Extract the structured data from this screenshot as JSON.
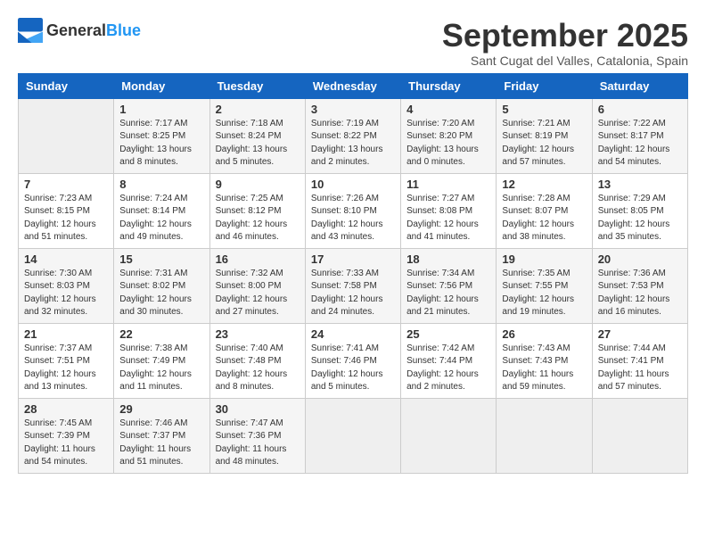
{
  "header": {
    "logo_general": "General",
    "logo_blue": "Blue",
    "month_title": "September 2025",
    "location": "Sant Cugat del Valles, Catalonia, Spain"
  },
  "days_of_week": [
    "Sunday",
    "Monday",
    "Tuesday",
    "Wednesday",
    "Thursday",
    "Friday",
    "Saturday"
  ],
  "weeks": [
    [
      {
        "day": "",
        "info": ""
      },
      {
        "day": "1",
        "info": "Sunrise: 7:17 AM\nSunset: 8:25 PM\nDaylight: 13 hours\nand 8 minutes."
      },
      {
        "day": "2",
        "info": "Sunrise: 7:18 AM\nSunset: 8:24 PM\nDaylight: 13 hours\nand 5 minutes."
      },
      {
        "day": "3",
        "info": "Sunrise: 7:19 AM\nSunset: 8:22 PM\nDaylight: 13 hours\nand 2 minutes."
      },
      {
        "day": "4",
        "info": "Sunrise: 7:20 AM\nSunset: 8:20 PM\nDaylight: 13 hours\nand 0 minutes."
      },
      {
        "day": "5",
        "info": "Sunrise: 7:21 AM\nSunset: 8:19 PM\nDaylight: 12 hours\nand 57 minutes."
      },
      {
        "day": "6",
        "info": "Sunrise: 7:22 AM\nSunset: 8:17 PM\nDaylight: 12 hours\nand 54 minutes."
      }
    ],
    [
      {
        "day": "7",
        "info": "Sunrise: 7:23 AM\nSunset: 8:15 PM\nDaylight: 12 hours\nand 51 minutes."
      },
      {
        "day": "8",
        "info": "Sunrise: 7:24 AM\nSunset: 8:14 PM\nDaylight: 12 hours\nand 49 minutes."
      },
      {
        "day": "9",
        "info": "Sunrise: 7:25 AM\nSunset: 8:12 PM\nDaylight: 12 hours\nand 46 minutes."
      },
      {
        "day": "10",
        "info": "Sunrise: 7:26 AM\nSunset: 8:10 PM\nDaylight: 12 hours\nand 43 minutes."
      },
      {
        "day": "11",
        "info": "Sunrise: 7:27 AM\nSunset: 8:08 PM\nDaylight: 12 hours\nand 41 minutes."
      },
      {
        "day": "12",
        "info": "Sunrise: 7:28 AM\nSunset: 8:07 PM\nDaylight: 12 hours\nand 38 minutes."
      },
      {
        "day": "13",
        "info": "Sunrise: 7:29 AM\nSunset: 8:05 PM\nDaylight: 12 hours\nand 35 minutes."
      }
    ],
    [
      {
        "day": "14",
        "info": "Sunrise: 7:30 AM\nSunset: 8:03 PM\nDaylight: 12 hours\nand 32 minutes."
      },
      {
        "day": "15",
        "info": "Sunrise: 7:31 AM\nSunset: 8:02 PM\nDaylight: 12 hours\nand 30 minutes."
      },
      {
        "day": "16",
        "info": "Sunrise: 7:32 AM\nSunset: 8:00 PM\nDaylight: 12 hours\nand 27 minutes."
      },
      {
        "day": "17",
        "info": "Sunrise: 7:33 AM\nSunset: 7:58 PM\nDaylight: 12 hours\nand 24 minutes."
      },
      {
        "day": "18",
        "info": "Sunrise: 7:34 AM\nSunset: 7:56 PM\nDaylight: 12 hours\nand 21 minutes."
      },
      {
        "day": "19",
        "info": "Sunrise: 7:35 AM\nSunset: 7:55 PM\nDaylight: 12 hours\nand 19 minutes."
      },
      {
        "day": "20",
        "info": "Sunrise: 7:36 AM\nSunset: 7:53 PM\nDaylight: 12 hours\nand 16 minutes."
      }
    ],
    [
      {
        "day": "21",
        "info": "Sunrise: 7:37 AM\nSunset: 7:51 PM\nDaylight: 12 hours\nand 13 minutes."
      },
      {
        "day": "22",
        "info": "Sunrise: 7:38 AM\nSunset: 7:49 PM\nDaylight: 12 hours\nand 11 minutes."
      },
      {
        "day": "23",
        "info": "Sunrise: 7:40 AM\nSunset: 7:48 PM\nDaylight: 12 hours\nand 8 minutes."
      },
      {
        "day": "24",
        "info": "Sunrise: 7:41 AM\nSunset: 7:46 PM\nDaylight: 12 hours\nand 5 minutes."
      },
      {
        "day": "25",
        "info": "Sunrise: 7:42 AM\nSunset: 7:44 PM\nDaylight: 12 hours\nand 2 minutes."
      },
      {
        "day": "26",
        "info": "Sunrise: 7:43 AM\nSunset: 7:43 PM\nDaylight: 11 hours\nand 59 minutes."
      },
      {
        "day": "27",
        "info": "Sunrise: 7:44 AM\nSunset: 7:41 PM\nDaylight: 11 hours\nand 57 minutes."
      }
    ],
    [
      {
        "day": "28",
        "info": "Sunrise: 7:45 AM\nSunset: 7:39 PM\nDaylight: 11 hours\nand 54 minutes."
      },
      {
        "day": "29",
        "info": "Sunrise: 7:46 AM\nSunset: 7:37 PM\nDaylight: 11 hours\nand 51 minutes."
      },
      {
        "day": "30",
        "info": "Sunrise: 7:47 AM\nSunset: 7:36 PM\nDaylight: 11 hours\nand 48 minutes."
      },
      {
        "day": "",
        "info": ""
      },
      {
        "day": "",
        "info": ""
      },
      {
        "day": "",
        "info": ""
      },
      {
        "day": "",
        "info": ""
      }
    ]
  ]
}
